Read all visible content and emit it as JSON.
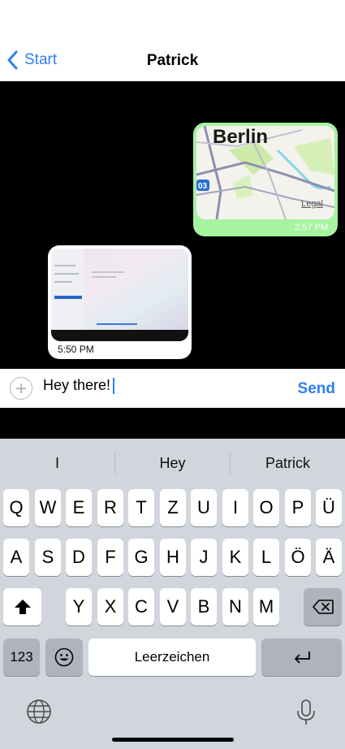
{
  "nav": {
    "back_label": "Start",
    "title": "Patrick"
  },
  "messages": [
    {
      "direction": "outgoing",
      "type": "map",
      "city": "Berlin",
      "map_legal": "Legal",
      "map_route_badge": "03",
      "time": "2:57 PM"
    },
    {
      "direction": "incoming",
      "type": "photo",
      "time": "5:50 PM"
    }
  ],
  "composer": {
    "text": "Hey there!",
    "send_label": "Send",
    "add_icon": "plus-circle-icon"
  },
  "keyboard": {
    "suggestions": [
      "I",
      "Hey",
      "Patrick"
    ],
    "row1": [
      "Q",
      "W",
      "E",
      "R",
      "T",
      "Z",
      "U",
      "I",
      "O",
      "P",
      "Ü"
    ],
    "row2": [
      "A",
      "S",
      "D",
      "F",
      "G",
      "H",
      "J",
      "K",
      "L",
      "Ö",
      "Ä"
    ],
    "row3": [
      "Y",
      "X",
      "C",
      "V",
      "B",
      "N",
      "M"
    ],
    "numbers_label": "123",
    "space_label": "Leerzeichen",
    "icons": [
      "shift-icon",
      "backspace-icon",
      "emoji-icon",
      "return-icon",
      "globe-icon",
      "microphone-icon"
    ]
  },
  "colors": {
    "accent": "#2f80ed",
    "outgoing_bubble": "#a6f3a0",
    "keyboard_bg": "#d1d5dc",
    "dark_key": "#aeb3bc"
  }
}
